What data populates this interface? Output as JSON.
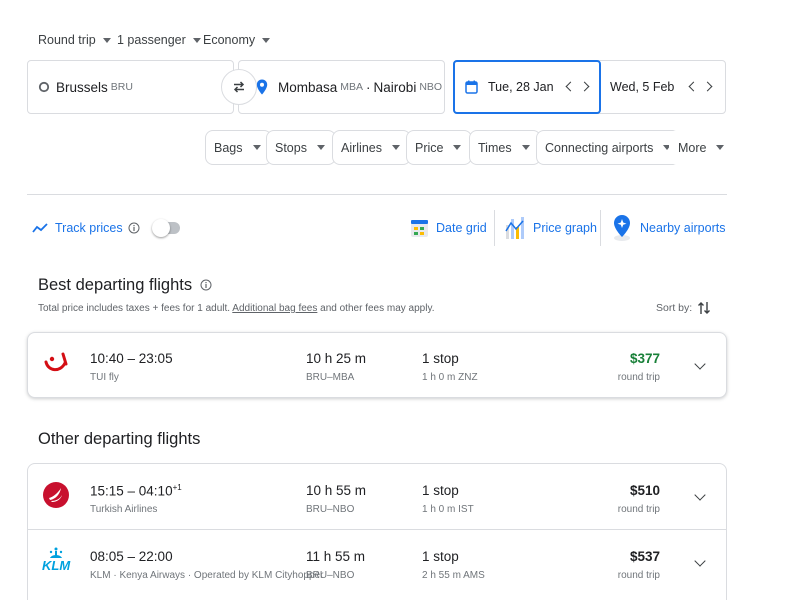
{
  "search": {
    "trip_type": "Round trip",
    "passengers": "1 passenger",
    "cabin": "Economy",
    "origin": {
      "city": "Brussels",
      "code": "BRU"
    },
    "destination": {
      "city1": "Mombasa",
      "code1": "MBA",
      "sep": "·",
      "city2": "Nairobi",
      "code2": "NBO"
    },
    "depart_date": "Tue, 28 Jan",
    "return_date": "Wed, 5 Feb"
  },
  "filters": [
    "Bags",
    "Stops",
    "Airlines",
    "Price",
    "Times",
    "Connecting airports",
    "More"
  ],
  "tools": {
    "track_prices": "Track prices",
    "date_grid": "Date grid",
    "price_graph": "Price graph",
    "nearby_airports": "Nearby airports"
  },
  "best": {
    "title": "Best departing flights",
    "subtitle_prefix": "Total price includes taxes + fees for 1 adult.",
    "subtitle_link": "Additional bag fees",
    "subtitle_suffix": "and other fees may apply.",
    "sort_label": "Sort by:"
  },
  "other": {
    "title": "Other departing flights"
  },
  "flights": [
    {
      "times": "10:40 – 23:05",
      "plus": "",
      "airline": "TUI fly",
      "duration": "10 h 25 m",
      "route": "BRU–MBA",
      "stops": "1 stop",
      "layover": "1 h 0 m ZNZ",
      "price": "$377",
      "price_note": "round trip"
    },
    {
      "times": "15:15 – 04:10",
      "plus": "+1",
      "airline": "Turkish Airlines",
      "duration": "10 h 55 m",
      "route": "BRU–NBO",
      "stops": "1 stop",
      "layover": "1 h 0 m IST",
      "price": "$510",
      "price_note": "round trip"
    },
    {
      "times": "08:05 – 22:00",
      "plus": "",
      "airline": "KLM · Kenya Airways · Operated by KLM Cityhopper",
      "duration": "11 h 55 m",
      "route": "BRU–NBO",
      "stops": "1 stop",
      "layover": "2 h 55 m AMS",
      "price": "$537",
      "price_note": "round trip",
      "logo_text": "KLM"
    }
  ],
  "colors": {
    "accent": "#1a73e8",
    "price_best": "#188038",
    "tui": "#d40e14",
    "turkish": "#c8102e",
    "klm": "#00a1de"
  }
}
